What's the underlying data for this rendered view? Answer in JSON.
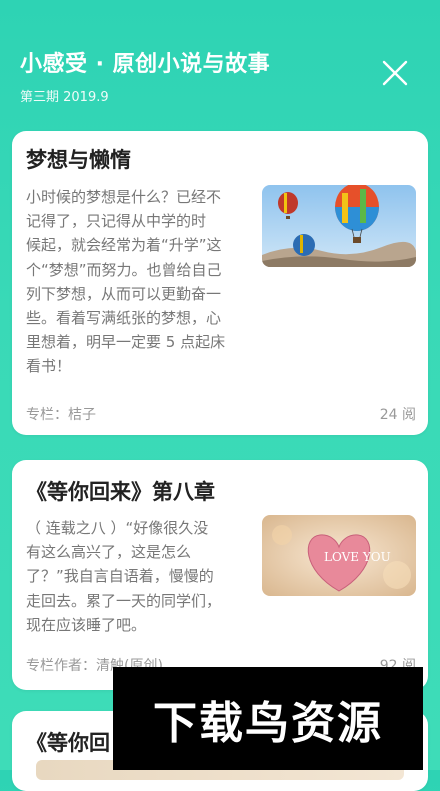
{
  "header": {
    "title": "小感受 · 原创小说与故事",
    "subtitle": "第三期 2019.9"
  },
  "cards": [
    {
      "title": "梦想与懒惰",
      "lines": [
        "小时候的梦想是什么？已经不",
        "记得了，只记得从中学的时",
        "候起，就会经常为着“升学”这",
        "个“梦想”而努力。也曾给自己",
        "列下梦想，从而可以更勤奋一",
        "些。看着写满纸张的梦想，心",
        "里想着，明早一定要 5 点起床",
        "看书！"
      ],
      "column": "专栏：桔子",
      "reads": "24 阅"
    },
    {
      "title": "《等你回来》第八章",
      "lines": [
        "（ 连载之八 ）“好像很久没",
        "有这么高兴了，这是怎么",
        "了？”我自言自语着，慢慢的",
        "走回去。累了一天的同学们，",
        "现在应该睡了吧。"
      ],
      "column": "专栏作者：清触(原创)",
      "reads": "92 阅",
      "thumb_text": "LOVE YOU"
    },
    {
      "title": "《等你回"
    }
  ],
  "watermark": "下载鸟资源",
  "colors": {
    "accent": "#2ed3b4",
    "card": "#ffffff",
    "title": "#222222",
    "body": "#777777"
  }
}
